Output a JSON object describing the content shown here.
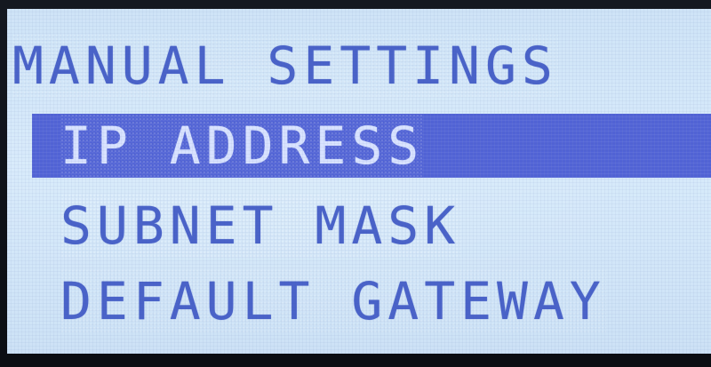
{
  "screen": {
    "title": "MANUAL SETTINGS",
    "menu_items": [
      {
        "label": "IP ADDRESS",
        "selected": true
      },
      {
        "label": "SUBNET MASK",
        "selected": false
      },
      {
        "label": "DEFAULT GATEWAY",
        "selected": false
      }
    ]
  },
  "colors": {
    "lcd_background": "#d3e7f9",
    "text": "#4a63c9",
    "highlight_background": "#5163d6",
    "highlight_text": "#d9e3ff"
  }
}
